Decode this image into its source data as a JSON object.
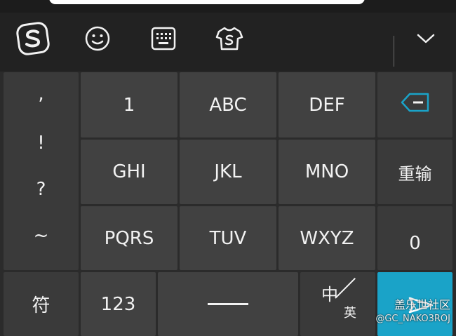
{
  "toolbar": {
    "items": [
      {
        "name": "sogou-logo-icon"
      },
      {
        "name": "emoji-icon"
      },
      {
        "name": "keyboard-icon"
      },
      {
        "name": "skin-shirt-icon"
      }
    ],
    "collapse": {
      "name": "chevron-down-icon"
    }
  },
  "keyboard": {
    "punctuation": [
      ",",
      "!",
      "?",
      "~"
    ],
    "rows": [
      [
        "1",
        "ABC",
        "DEF"
      ],
      [
        "GHI",
        "JKL",
        "MNO"
      ],
      [
        "PQRS",
        "TUV",
        "WXYZ"
      ]
    ],
    "right_column": {
      "backspace": "backspace-icon",
      "retype": "重输",
      "zero": "0"
    },
    "bottom_row": {
      "symbols": "符",
      "numbers": "123",
      "lang_zh": "中",
      "lang_en": "英"
    }
  },
  "colors": {
    "accent": "#1aa3c8",
    "key": "#414141",
    "side_key": "#3a3a3a",
    "background": "#2b2b2b",
    "toolbar": "#222222"
  },
  "watermark": {
    "site": "盖乐世社区",
    "handle": "@GC_NAKO3ROJ"
  }
}
